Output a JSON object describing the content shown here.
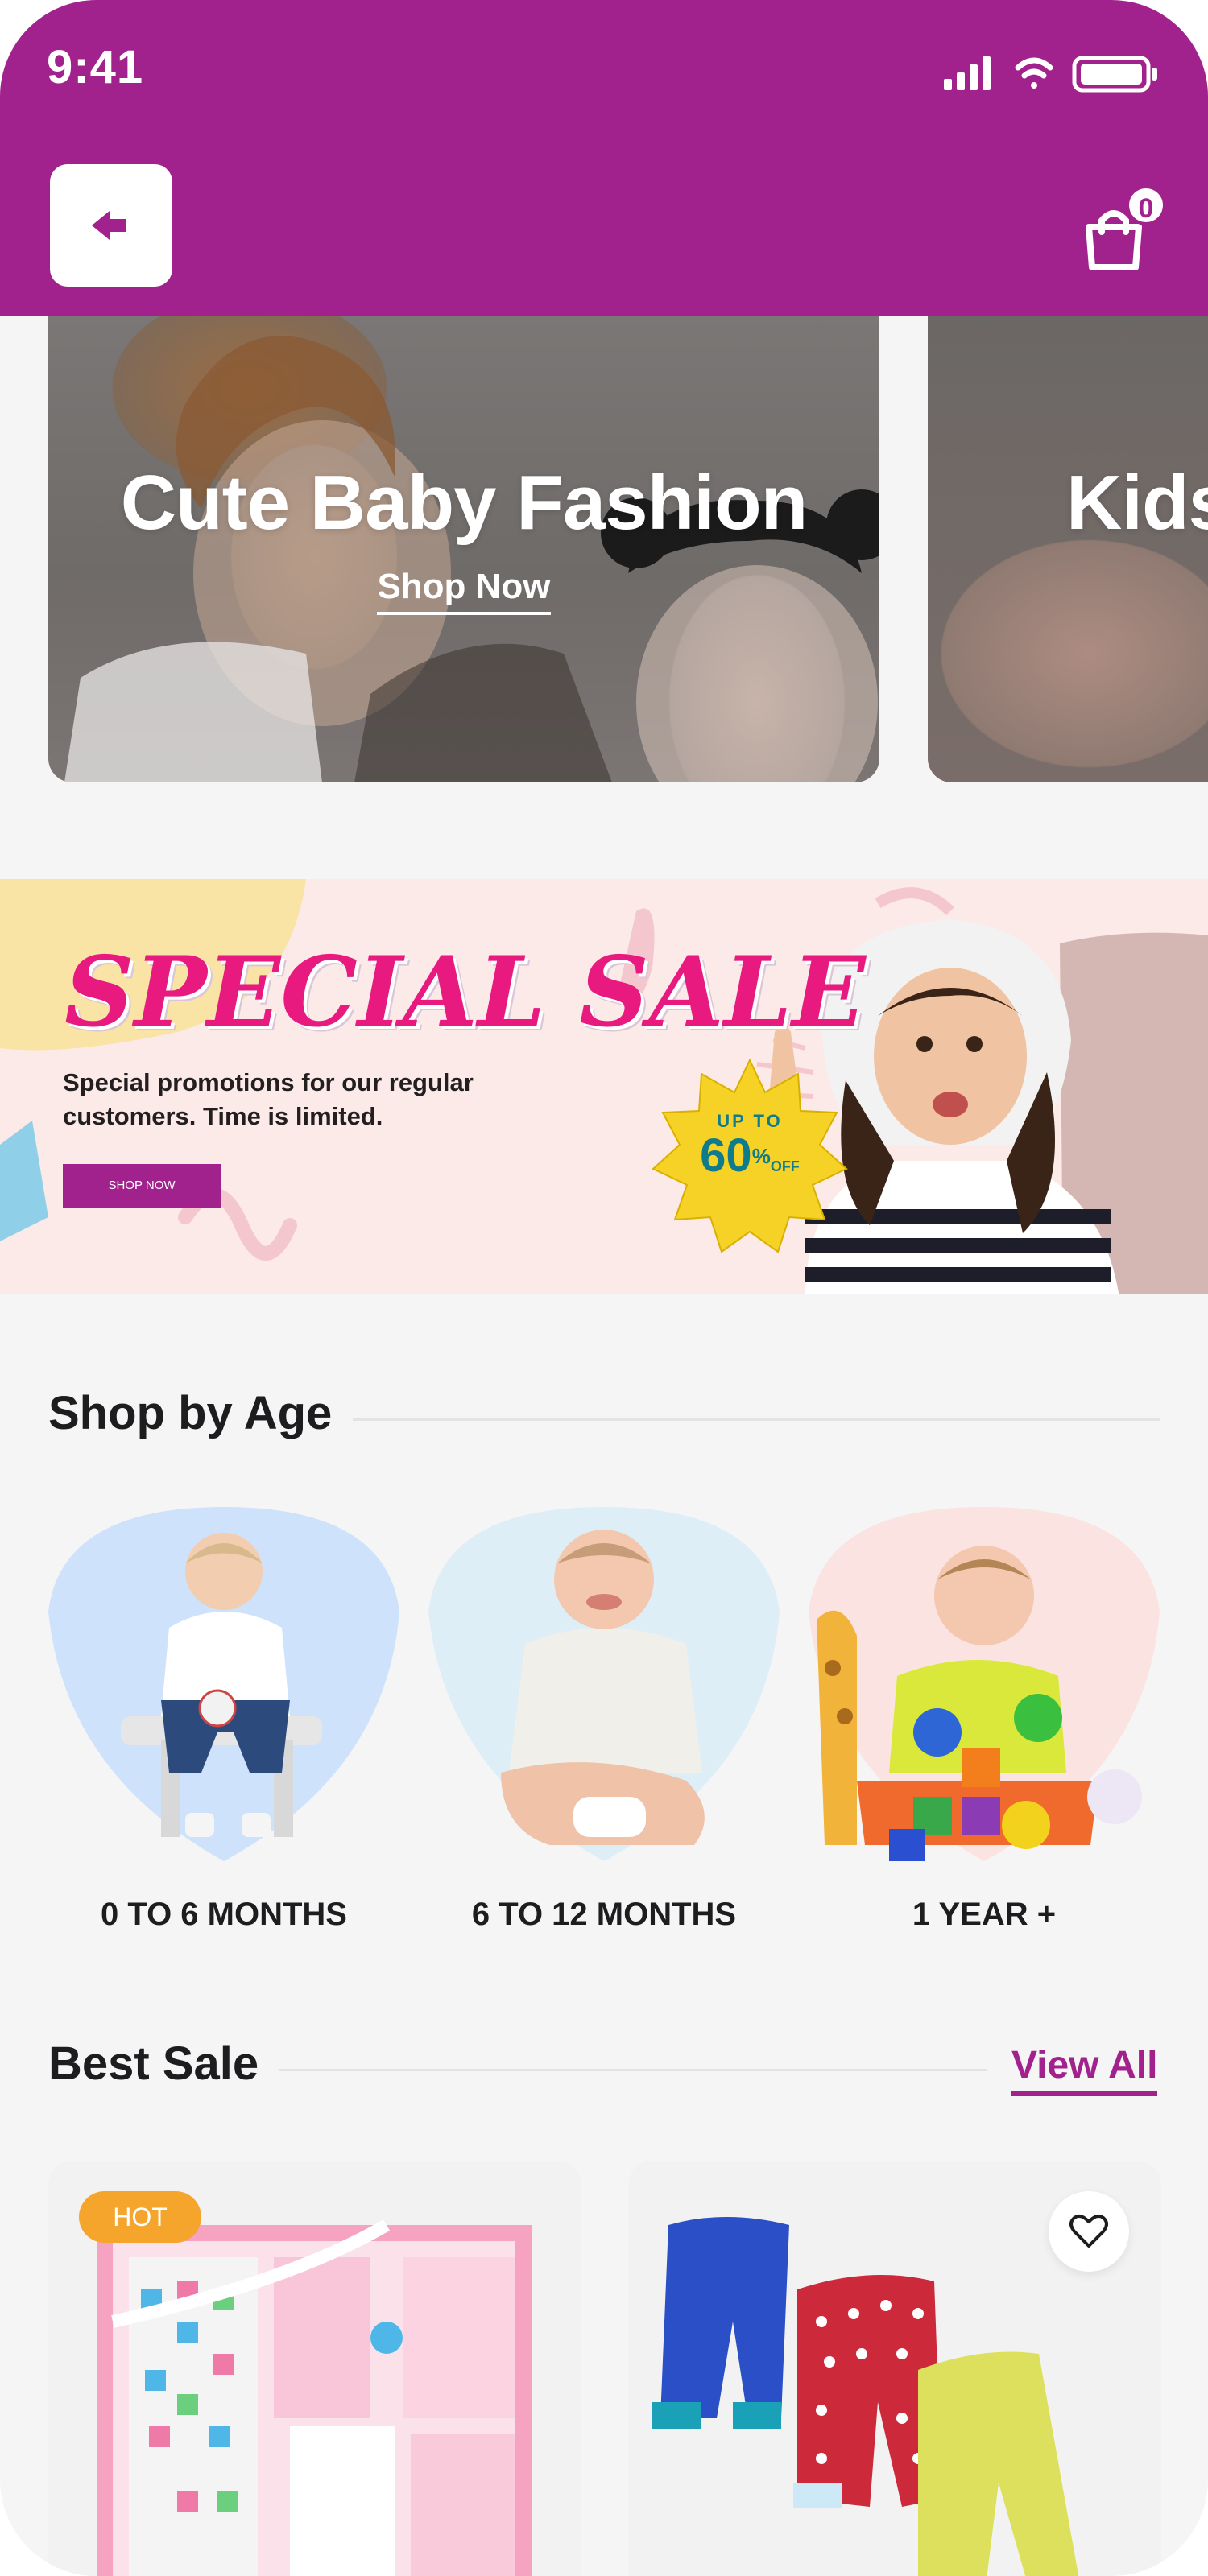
{
  "status_bar": {
    "time": "9:41"
  },
  "header": {
    "cart_count": "0",
    "accent": "#a2228d"
  },
  "hero_slides": [
    {
      "title": "Cute Baby Fashion",
      "cta": "Shop Now"
    },
    {
      "title": "Kids",
      "cta": ""
    }
  ],
  "sale_banner": {
    "title": "SPECIAL SALE",
    "text": "Special promotions for our regular customers. Time is limited.",
    "button": "SHOP NOW",
    "badge_upto": "UP TO",
    "badge_value": "60",
    "badge_percent": "%",
    "badge_off": "OFF"
  },
  "shop_by_age": {
    "title": "Shop by Age",
    "items": [
      {
        "label": "0 TO 6 MONTHS",
        "bg": "#cfe2fb"
      },
      {
        "label": "6 TO 12 MONTHS",
        "bg": "#ddeef7"
      },
      {
        "label": "1 YEAR +",
        "bg": "#fbe3e1"
      }
    ]
  },
  "best_sale": {
    "title": "Best Sale",
    "view_all": "View All",
    "products": [
      {
        "badge": "HOT"
      },
      {
        "badge": ""
      }
    ]
  }
}
